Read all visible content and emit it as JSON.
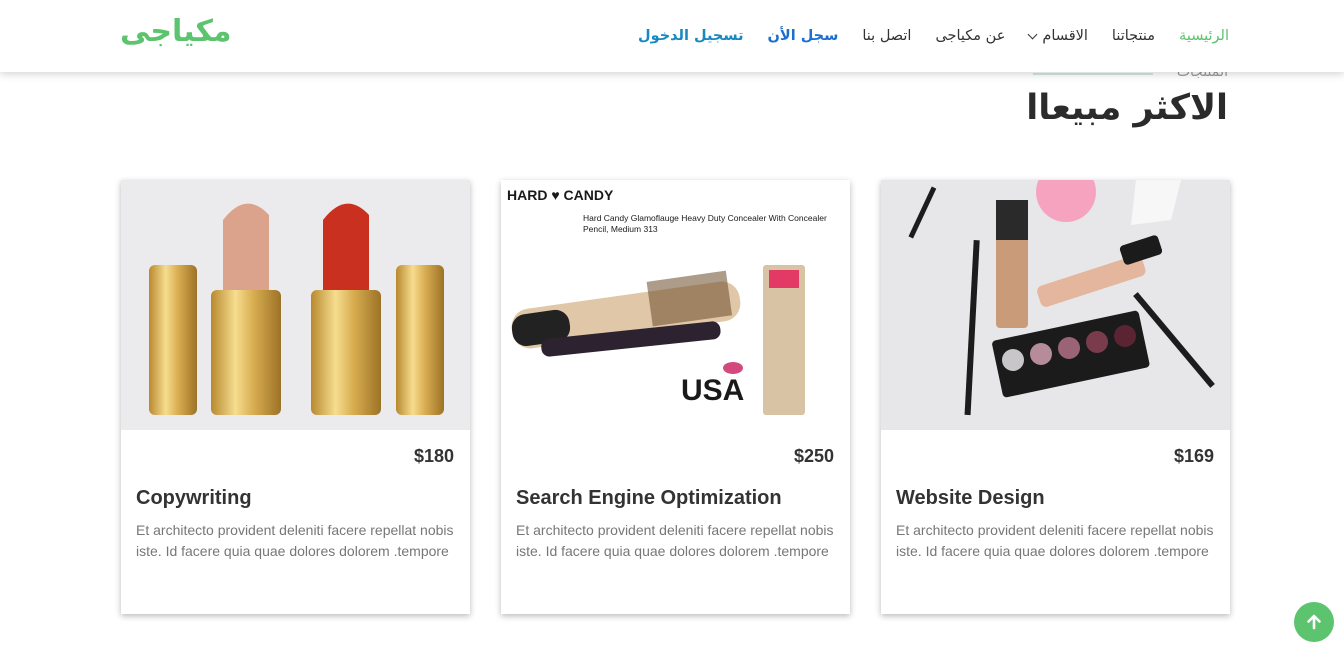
{
  "brand": {
    "logo": "مكياجى",
    "accent": "#5cc36f"
  },
  "nav": {
    "items": [
      {
        "label": "الرئيسية"
      },
      {
        "label": "منتجاتنا"
      },
      {
        "label": "الاقسام"
      },
      {
        "label": "عن مكياجى"
      },
      {
        "label": "اتصل بنا"
      },
      {
        "label": "سجل الأن"
      },
      {
        "label": "تسجيل الدخول"
      }
    ]
  },
  "section": {
    "subtitle": "المنتجات",
    "title": "الاكثر مبيعاا"
  },
  "products": [
    {
      "price": "$169",
      "title": "Website Design",
      "desc": "Et architecto provident deleniti facere repellat nobis iste. Id facere quia quae dolores dolorem .tempore"
    },
    {
      "price": "$250",
      "title": "Search Engine Optimization",
      "desc": "Et architecto provident deleniti facere repellat nobis iste. Id facere quia quae dolores dolorem .tempore",
      "image_text": {
        "brand": "HARD ♥ CANDY",
        "caption": "Hard Candy Glamoflauge Heavy Duty Concealer With Concealer Pencil, Medium 313",
        "usa": "USA"
      }
    },
    {
      "price": "$180",
      "title": "Copywriting",
      "desc": "Et architecto provident deleniti facere repellat nobis iste. Id facere quia quae dolores dolorem .tempore"
    }
  ],
  "icons": {
    "scroll_top": "arrow-up-icon"
  }
}
